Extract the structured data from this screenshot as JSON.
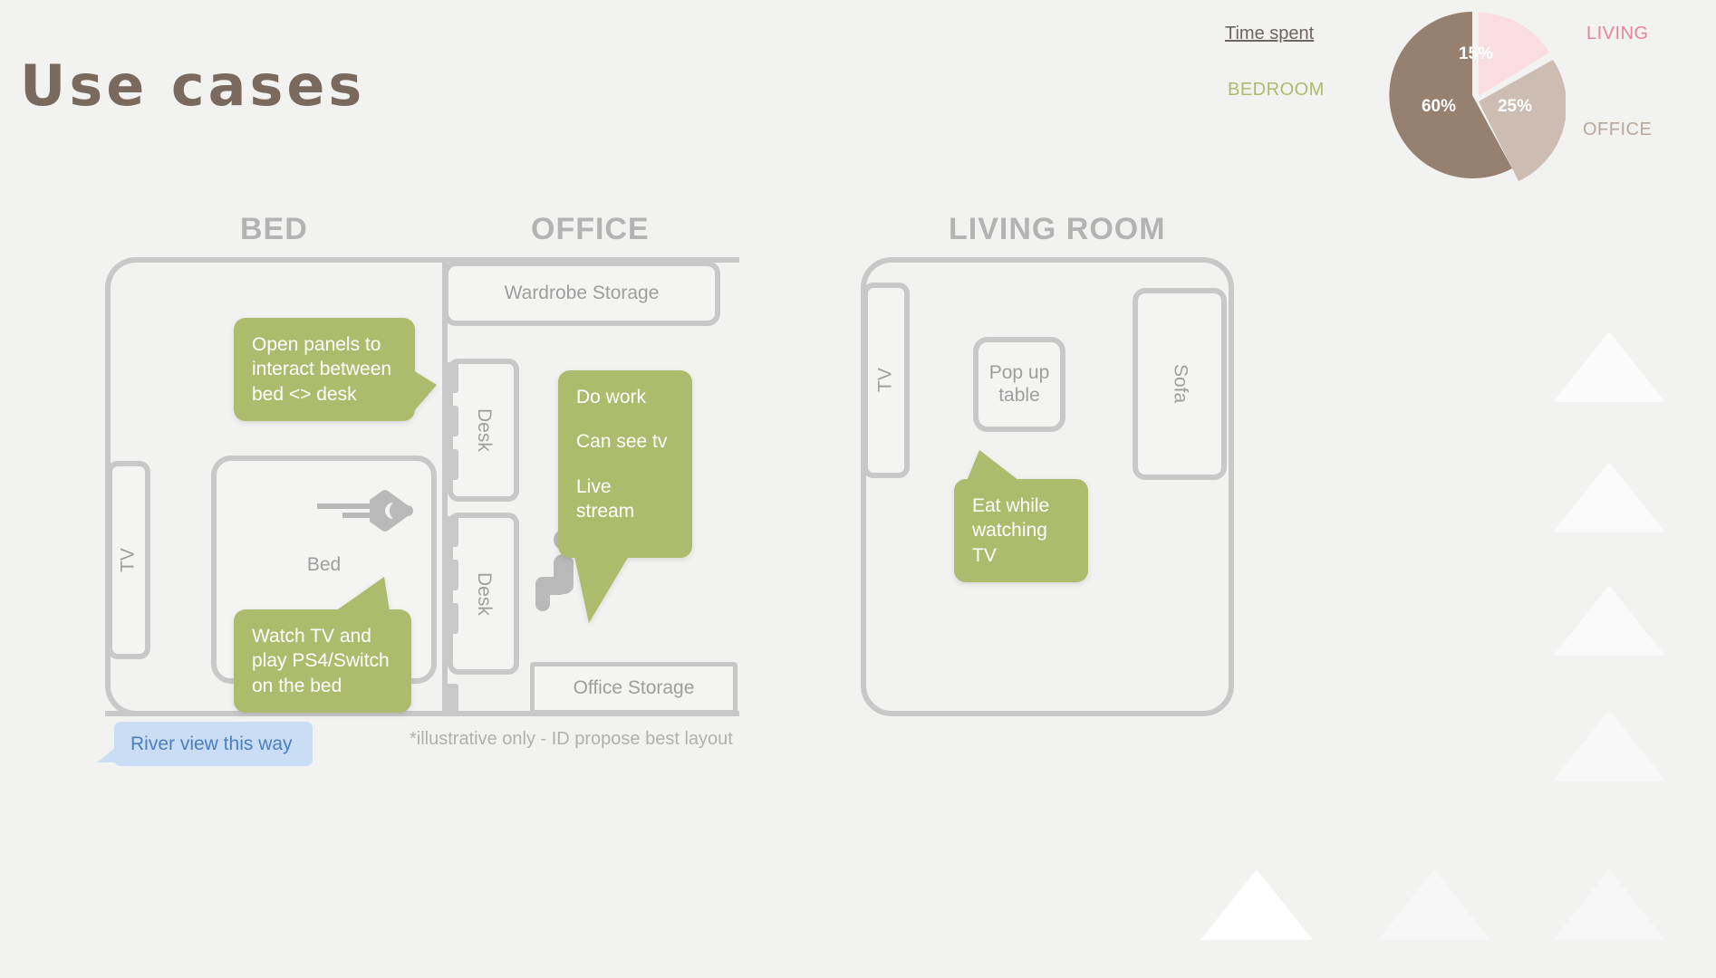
{
  "title": "Use cases",
  "chart_data": {
    "type": "pie",
    "title": "Time spent",
    "categories": [
      "LIVING",
      "OFFICE",
      "BEDROOM"
    ],
    "values": [
      15,
      25,
      60
    ],
    "labels": [
      "15%",
      "25%",
      "60%"
    ],
    "colors": [
      "#fadde0",
      "#cdbcb1",
      "#96806f"
    ],
    "legend_position": "around",
    "legend": [
      {
        "label": "LIVING",
        "color": "#e8839a"
      },
      {
        "label": "OFFICE",
        "color": "#b7a89d"
      },
      {
        "label": "BEDROOM",
        "color": "#adbb6d"
      }
    ]
  },
  "pie": {
    "caption": "Time spent",
    "slice_living": "15%",
    "slice_office": "25%",
    "slice_bedroom": "60%",
    "legend_living": "LIVING",
    "legend_bedroom": "BEDROOM",
    "legend_office": "OFFICE"
  },
  "sections": {
    "bed": "BED",
    "office": "OFFICE",
    "living": "LIVING ROOM"
  },
  "furniture": {
    "tv_bedroom": "TV",
    "bed": "Bed",
    "wardrobe_storage": "Wardrobe Storage",
    "desk_top": "Desk",
    "desk_bottom": "Desk",
    "office_storage": "Office Storage",
    "tv_living": "TV",
    "popup_table": "Pop up table",
    "sofa": "Sofa"
  },
  "bubbles": {
    "open_panels": "Open panels to interact between bed <> desk",
    "do_work_line1": "Do work",
    "do_work_line2": "Can see tv",
    "do_work_line3": "Live stream",
    "watch_tv": "Watch TV and play PS4/Switch on the bed",
    "eat": "Eat while watching TV",
    "river_view": "River view this way"
  },
  "footnote": "*illustrative only - ID propose best layout",
  "colors": {
    "background": "#f2f2f0",
    "title": "#7a6a5d",
    "bubble_green": "#adbb6d",
    "bubble_blue": "#c9ddf4",
    "outline_gray": "#c8c8c8"
  }
}
